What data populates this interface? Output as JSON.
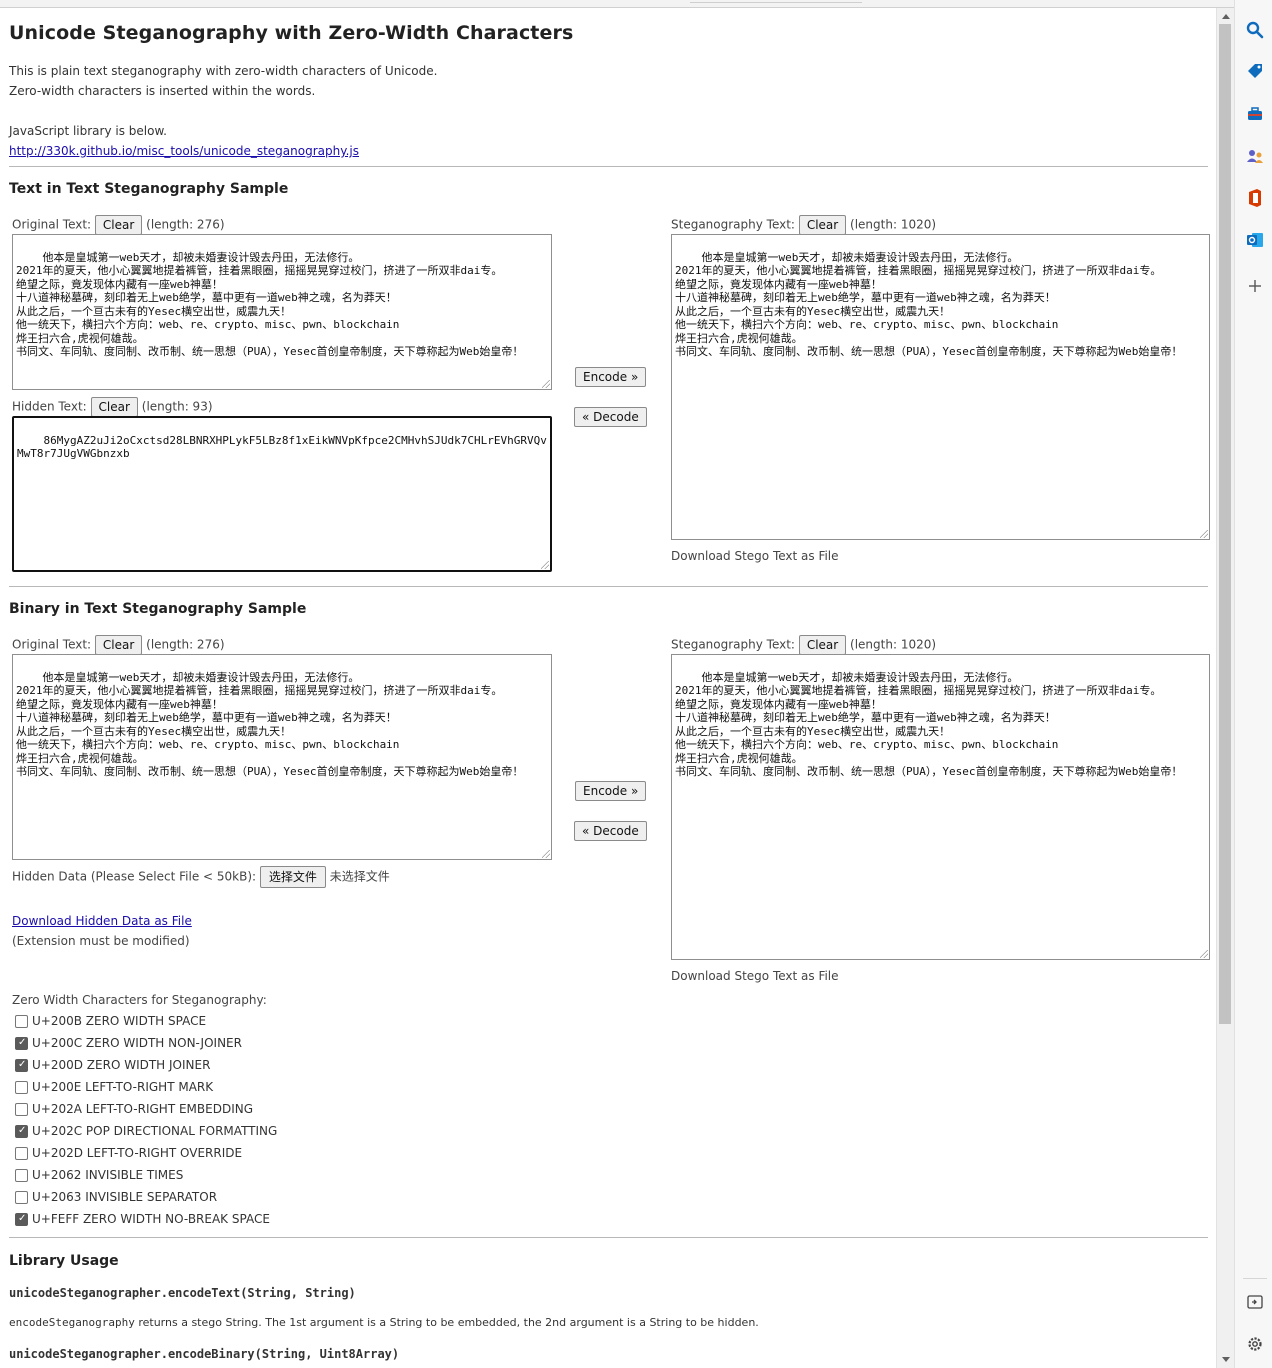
{
  "title": "Unicode Steganography with Zero-Width Characters",
  "intro": {
    "line1": "This is plain text steganography with zero-width characters of Unicode.",
    "line2": "Zero-width characters is inserted within the words.",
    "line3": "JavaScript library is below.",
    "library_link": "http://330k.github.io/misc_tools/unicode_steganography.js"
  },
  "text_section": {
    "heading": "Text in Text Steganography Sample",
    "original_label": "Original Text:",
    "original_clear": "Clear",
    "original_length": "(length: 276)",
    "original_text": "他本是皇城第一web天才，却被未婚妻设计毁去丹田，无法修行。\n2021年的夏天，他小心翼翼地提着裤管，挂着黑眼圈，摇摇晃晃穿过校门，挤进了一所双非dai专。\n绝望之际，竟发现体内藏有一座web神墓！\n十八道神秘墓碑，刻印着无上web绝学，墓中更有一道web神之魂，名为莽天！\n从此之后，一个亘古未有的Yesec横空出世，威震九天！\n他一统天下，横扫六个方向：web、re、crypto、misc、pwn、blockchain\n烨王扫六合,虎视何雄哉。\n书同文、车同轨、度同制、改币制、统一思想（PUA），Yesec首创皇帝制度，天下尊称起为Web始皇帝！",
    "hidden_label": "Hidden Text:",
    "hidden_clear": "Clear",
    "hidden_length": "(length: 93)",
    "hidden_text": "86MygAZ2uJi2oCxctsd28LBNRXHPLykF5LBz8f1xEikWNVpKfpce2CMHvhSJUdk7CHLrEVhGRVQvMwT8r7JUgVWGbnzxb",
    "encode_btn": "Encode »",
    "decode_btn": "« Decode",
    "stego_label": "Steganography Text:",
    "stego_clear": "Clear",
    "stego_length": "(length: 1020)",
    "stego_text": "他本是皇城第一web天才，却被未婚妻设计毁去丹田，无法修行。\n2021年的夏天，他小心翼翼地提着裤管，挂着黑眼圈，摇摇晃晃穿过校门，挤进了一所双非dai专。\n绝望之际，竟发现体内藏有一座web神墓！\n十八道神秘墓碑，刻印着无上web绝学，墓中更有一道web神之魂，名为莽天！\n从此之后，一个亘古未有的Yesec横空出世，威震九天！\n他一统天下，横扫六个方向：web、re、crypto、misc、pwn、blockchain\n烨王扫六合,虎视何雄哉。\n书同文、车同轨、度同制、改币制、统一思想（PUA），Yesec首创皇帝制度，天下尊称起为Web始皇帝！",
    "download_stego": "Download Stego Text as File"
  },
  "binary_section": {
    "heading": "Binary in Text Steganography Sample",
    "original_label": "Original Text:",
    "original_clear": "Clear",
    "original_length": "(length: 276)",
    "original_text": "他本是皇城第一web天才，却被未婚妻设计毁去丹田，无法修行。\n2021年的夏天，他小心翼翼地提着裤管，挂着黑眼圈，摇摇晃晃穿过校门，挤进了一所双非dai专。\n绝望之际，竟发现体内藏有一座web神墓！\n十八道神秘墓碑，刻印着无上web绝学，墓中更有一道web神之魂，名为莽天！\n从此之后，一个亘古未有的Yesec横空出世，威震九天！\n他一统天下，横扫六个方向：web、re、crypto、misc、pwn、blockchain\n烨王扫六合,虎视何雄哉。\n书同文、车同轨、度同制、改币制、统一思想（PUA），Yesec首创皇帝制度，天下尊称起为Web始皇帝！",
    "hidden_data_label": "Hidden Data (Please Select File < 50kB):",
    "choose_file_btn": "选择文件",
    "no_file_text": "未选择文件",
    "download_hidden": "Download Hidden Data as File",
    "extension_note": "(Extension must be modified)",
    "encode_btn": "Encode »",
    "decode_btn": "« Decode",
    "stego_label": "Steganography Text:",
    "stego_clear": "Clear",
    "stego_length": "(length: 1020)",
    "stego_text": "他本是皇城第一web天才，却被未婚妻设计毁去丹田，无法修行。\n2021年的夏天，他小心翼翼地提着裤管，挂着黑眼圈，摇摇晃晃穿过校门，挤进了一所双非dai专。\n绝望之际，竟发现体内藏有一座web神墓！\n十八道神秘墓碑，刻印着无上web绝学，墓中更有一道web神之魂，名为莽天！\n从此之后，一个亘古未有的Yesec横空出世，威震九天！\n他一统天下，横扫六个方向：web、re、crypto、misc、pwn、blockchain\n烨王扫六合,虎视何雄哉。\n书同文、车同轨、度同制、改币制、统一思想（PUA），Yesec首创皇帝制度，天下尊称起为Web始皇帝！",
    "download_stego": "Download Stego Text as File"
  },
  "zero_width": {
    "label": "Zero Width Characters for Steganography:",
    "options": [
      {
        "label": "U+200B ZERO WIDTH SPACE",
        "checked": false
      },
      {
        "label": "U+200C ZERO WIDTH NON-JOINER",
        "checked": true
      },
      {
        "label": "U+200D ZERO WIDTH JOINER",
        "checked": true
      },
      {
        "label": "U+200E LEFT-TO-RIGHT MARK",
        "checked": false
      },
      {
        "label": "U+202A LEFT-TO-RIGHT EMBEDDING",
        "checked": false
      },
      {
        "label": "U+202C POP DIRECTIONAL FORMATTING",
        "checked": true
      },
      {
        "label": "U+202D LEFT-TO-RIGHT OVERRIDE",
        "checked": false
      },
      {
        "label": "U+2062 INVISIBLE TIMES",
        "checked": false
      },
      {
        "label": "U+2063 INVISIBLE SEPARATOR",
        "checked": false
      },
      {
        "label": "U+FEFF ZERO WIDTH NO-BREAK SPACE",
        "checked": true
      }
    ]
  },
  "library_usage": {
    "heading": "Library Usage",
    "fn1": "unicodeSteganographer.encodeText(String, String)",
    "fn1_name": "encodeSteganography",
    "fn1_desc": " returns a stego String. The 1st argument is a String to be embedded, the 2nd argument is a String to be hidden.",
    "fn2": "unicodeSteganographer.encodeBinary(String, Uint8Array)"
  },
  "browser_sidebar": {
    "icons": [
      "search-icon",
      "tag-icon",
      "toolbox-icon",
      "people-icon",
      "office-icon",
      "outlook-icon",
      "plus-icon",
      "panel-icon",
      "settings-icon"
    ],
    "colors": {
      "search": "#0f6cbd",
      "tag": "#0f6cbd",
      "office": "#d83b01",
      "outlook": "#0f6cbd",
      "people": "#5b5fc7"
    }
  }
}
